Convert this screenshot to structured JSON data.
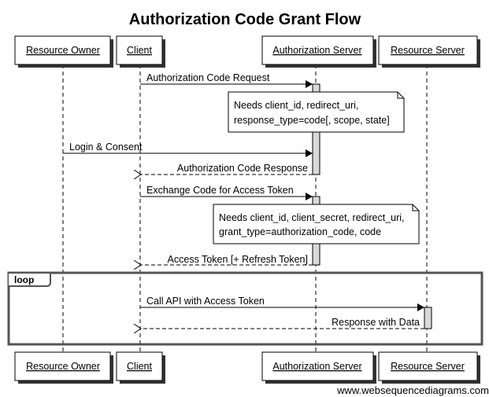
{
  "title": "Authorization Code Grant Flow",
  "participants": [
    {
      "id": "owner",
      "label": "Resource Owner"
    },
    {
      "id": "client",
      "label": "Client"
    },
    {
      "id": "auth",
      "label": "Authorization Server"
    },
    {
      "id": "resource",
      "label": "Resource Server"
    }
  ],
  "messages": [
    {
      "from": "client",
      "to": "auth",
      "label": "Authorization Code Request",
      "style": "solid"
    },
    {
      "from": "owner",
      "to": "auth",
      "label": "Login & Consent",
      "style": "solid"
    },
    {
      "from": "auth",
      "to": "client",
      "label": "Authorization Code Response",
      "style": "dashed"
    },
    {
      "from": "client",
      "to": "auth",
      "label": "Exchange Code for Access Token",
      "style": "solid"
    },
    {
      "from": "auth",
      "to": "client",
      "label": "Access Token [+ Refresh Token]",
      "style": "dashed"
    },
    {
      "from": "client",
      "to": "resource",
      "label": "Call API with Access Token",
      "style": "solid"
    },
    {
      "from": "resource",
      "to": "client",
      "label": "Response with Data",
      "style": "dashed"
    }
  ],
  "notes": [
    {
      "over": "auth",
      "lines": [
        "Needs client_id, redirect_uri,",
        "response_type=code[, scope, state]"
      ]
    },
    {
      "over": "auth",
      "lines": [
        "Needs client_id, client_secret, redirect_uri,",
        "grant_type=authorization_code, code"
      ]
    }
  ],
  "frames": [
    {
      "label": "loop"
    }
  ],
  "footer": {
    "credit": "www.websequencediagrams.com"
  },
  "colors": {
    "activation_fill": "#d9d9d9",
    "frame_stroke": "#555555",
    "shadow": "#333333"
  }
}
